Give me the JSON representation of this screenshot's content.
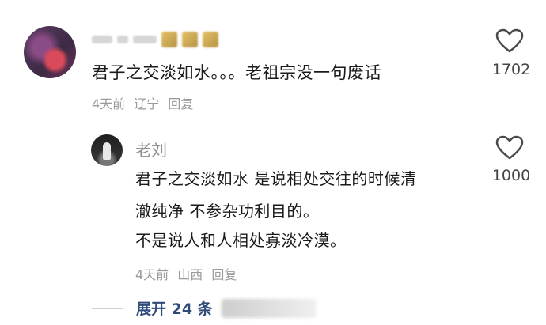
{
  "comment": {
    "text": "君子之交淡如水。。。老祖宗没一句废话",
    "time": "4天前",
    "location": "辽宁",
    "reply_label": "回复",
    "like_count": "1702"
  },
  "reply": {
    "author": "老刘",
    "line1": "君子之交淡如水 是说相处交往的时候清",
    "line2": "澈纯净 不参杂功利目的。",
    "line3": "不是说人和人相处寡淡冷漠。",
    "time": "4天前",
    "location": "山西",
    "reply_label": "回复",
    "like_count": "1000"
  },
  "expand": {
    "label": "展开 24 条"
  },
  "colors": {
    "link": "#2f4b7a",
    "meta": "#9a9a9a",
    "text": "#1a1a1a"
  },
  "icons": {
    "like": "heart-outline-icon"
  }
}
